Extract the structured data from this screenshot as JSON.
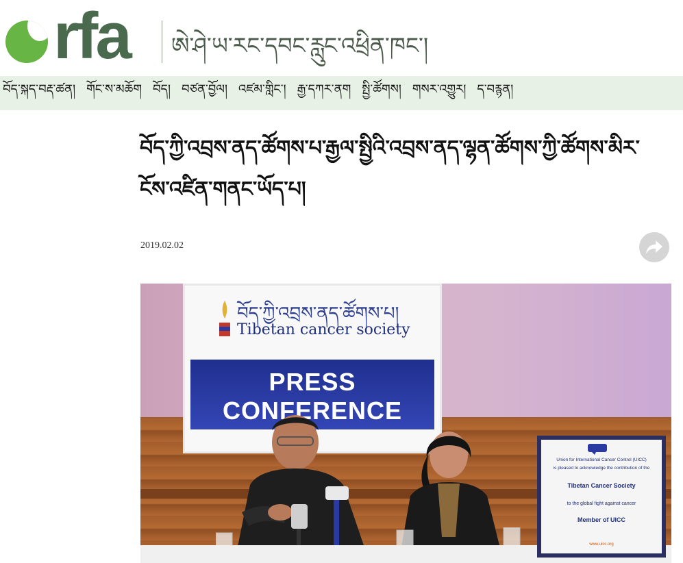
{
  "header": {
    "logo_text": "rfa",
    "service_name": "ཨེ་ཤེ་ཡ་རང་དབང་རླུང་འཕྲིན་ཁང་།"
  },
  "nav": {
    "items": [
      "བོད་སྐད་བརྡ་ཚན།",
      "གོང་ས་མཆོག",
      "བོད།",
      "བཙན་བྱོལ།",
      "འཛམ་གླིང་།",
      "རྒྱ་དཀར་ནག",
      "སྤྱི་ཚོགས།",
      "གསར་འགྱུར།",
      "ད་བརྙན།"
    ]
  },
  "article": {
    "headline": "བོད་ཀྱི་འབྲས་ནད་ཚོགས་པ་རྒྱལ་སྤྱིའི་འབྲས་ནད་ལྷན་ཚོགས་ཀྱི་ཚོགས་མིར་ངོས་འཛིན་གནང་ཡོད་པ།",
    "date": "2019.02.02"
  },
  "photo": {
    "banner_tibetan": "བོད་ཀྱི་འབྲས་ནད་ཚོགས་པ།",
    "banner_org": "Tibetan cancer society",
    "banner_press": "PRESS CONFERENCE",
    "cert_lines": [
      "Union for International Cancer Control (UICC)",
      "is pleased to acknowledge the contribution of the",
      "Tibetan Cancer Society",
      "to the global fight against cancer",
      "Member of UICC",
      "www.uicc.org"
    ]
  },
  "colors": {
    "logo_green": "#67b544",
    "logo_text": "#4a6a4e",
    "nav_bg": "#e8f1e6",
    "banner_blue": "#2a3aa0"
  },
  "icons": {
    "share": "share-arrow-icon"
  }
}
